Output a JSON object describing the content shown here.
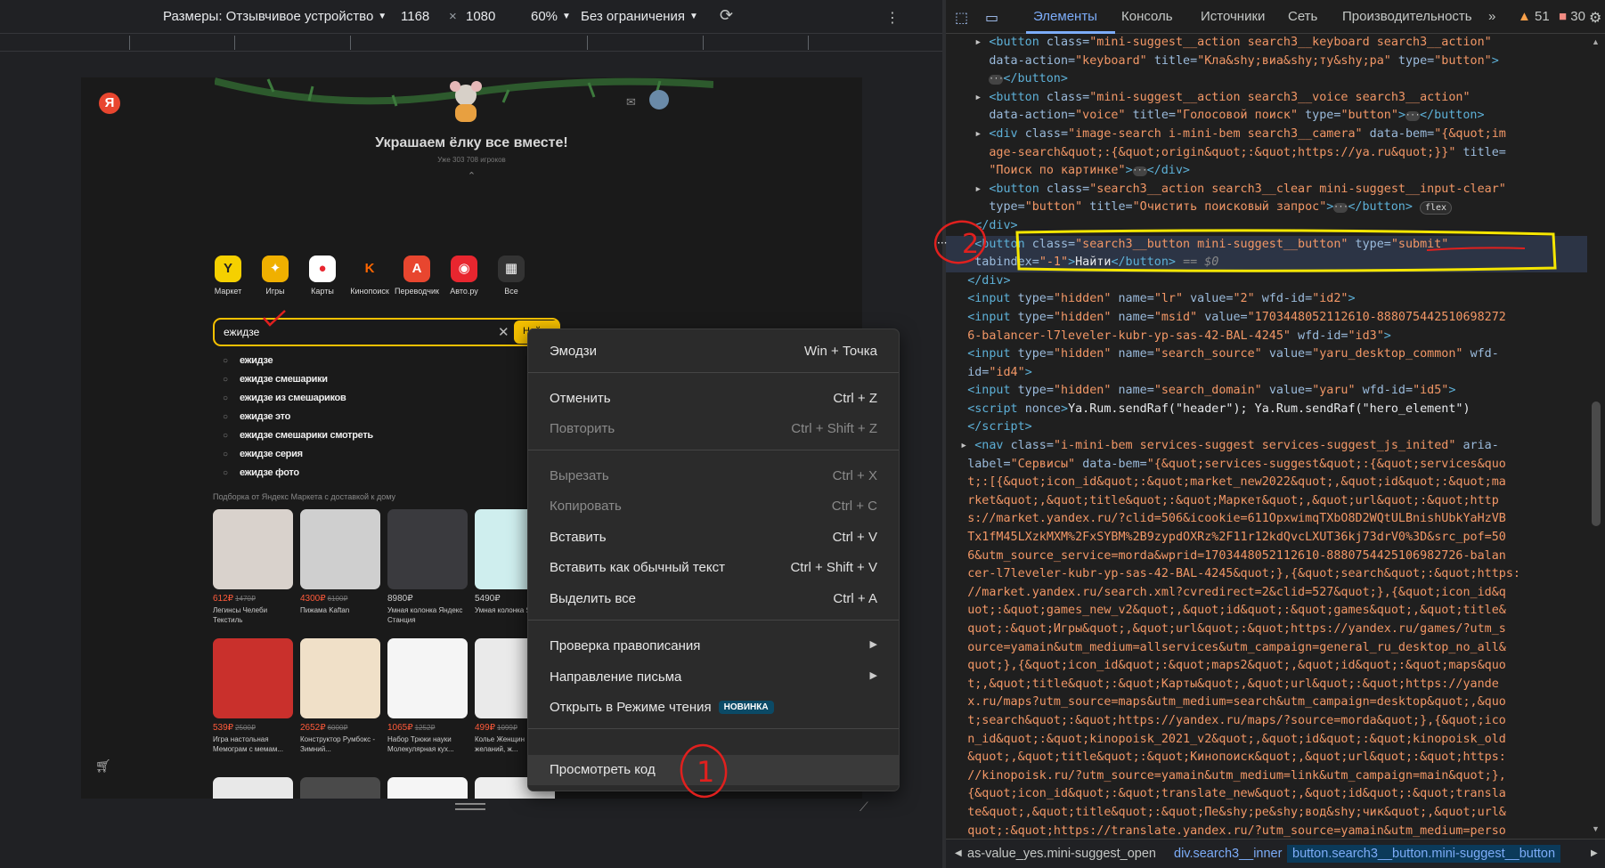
{
  "devbar": {
    "dimensions_label": "Размеры: Отзывчивое устройство",
    "width": "1168",
    "times": "×",
    "height": "1080",
    "zoom": "60%",
    "throttling": "Без ограничения"
  },
  "page": {
    "logo": "Я",
    "banner_title": "Украшаем ёлку все вместе!",
    "banner_sub": "Уже 303 708 игроков",
    "services": [
      {
        "label": "Маркет",
        "glyph": "Y",
        "color": "#f5d000"
      },
      {
        "label": "Игры",
        "glyph": "✦",
        "color": "#f0b000"
      },
      {
        "label": "Карты",
        "glyph": "●",
        "color": "#ffffff"
      },
      {
        "label": "Кинопоиск",
        "glyph": "K",
        "color": "#1a1a1a"
      },
      {
        "label": "Переводчик",
        "glyph": "A",
        "color": "#e8462f"
      },
      {
        "label": "Авто.ру",
        "glyph": "◉",
        "color": "#e8262f"
      },
      {
        "label": "Все",
        "glyph": "▦",
        "color": "#333333"
      }
    ],
    "search_query": "ежидзе",
    "search_button": "Найти",
    "suggestions": [
      "ежидзе",
      "ежидзе смешарики",
      "ежидзе из смешариков",
      "ежидзе это",
      "ежидзе смешарики смотреть",
      "ежидзе серия",
      "ежидзе фото"
    ],
    "market_sub": "Подборка от Яндекс Маркета с доставкой к дому",
    "products_row1": [
      {
        "price": "612₽",
        "old": "1470₽",
        "name": "Легинсы Челеби Текстиль",
        "color": "#d9d2cc"
      },
      {
        "price": "4300₽",
        "old": "6100₽",
        "name": "Пижама Kaftan",
        "color": "#cfcfcf"
      },
      {
        "price": "8980₽",
        "old": "",
        "name": "Умная колонка Яндекс Станция",
        "color": "#3a3a3e"
      },
      {
        "price": "5490₽",
        "old": "",
        "name": "Умная колонка Яндекс",
        "color": "#cfeeee"
      }
    ],
    "products_row2": [
      {
        "price": "539₽",
        "old": "2500₽",
        "name": "Игра настольная Мемограм с мемам...",
        "color": "#c9302c"
      },
      {
        "price": "2652₽",
        "old": "6000₽",
        "name": "Конструктор Румбокс - Зимний...",
        "color": "#f0e0c8"
      },
      {
        "price": "1065₽",
        "old": "1252₽",
        "name": "Набор Трюки науки Молекулярная кух...",
        "color": "#f5f5f5"
      },
      {
        "price": "499₽",
        "old": "1099₽",
        "name": "Колье Женщин желаний, ж...",
        "color": "#eaeaea"
      }
    ]
  },
  "context_menu": {
    "items": [
      {
        "label": "Эмодзи",
        "shortcut": "Win + Точка",
        "disabled": false
      },
      {
        "label": "Отменить",
        "shortcut": "Ctrl + Z",
        "disabled": false
      },
      {
        "label": "Повторить",
        "shortcut": "Ctrl + Shift + Z",
        "disabled": true
      },
      {
        "label": "Вырезать",
        "shortcut": "Ctrl + X",
        "disabled": true
      },
      {
        "label": "Копировать",
        "shortcut": "Ctrl + C",
        "disabled": true
      },
      {
        "label": "Вставить",
        "shortcut": "Ctrl + V",
        "disabled": false
      },
      {
        "label": "Вставить как обычный текст",
        "shortcut": "Ctrl + Shift + V",
        "disabled": false
      },
      {
        "label": "Выделить все",
        "shortcut": "Ctrl + A",
        "disabled": false
      },
      {
        "label": "Проверка правописания",
        "shortcut": "",
        "disabled": false
      },
      {
        "label": "Направление письма",
        "shortcut": "",
        "disabled": false
      },
      {
        "label": "Открыть в Режиме чтения",
        "shortcut": "",
        "disabled": false
      },
      {
        "label": "Просмотреть код",
        "shortcut": "",
        "disabled": false
      }
    ],
    "new_badge": "НОВИНКА"
  },
  "devtools": {
    "tabs": [
      "Элементы",
      "Консоль",
      "Источники",
      "Сеть",
      "Производительность"
    ],
    "more": "»",
    "warnings": "51",
    "errors": "30",
    "breadcrumbs": [
      "as-value_yes.mini-suggest_open",
      "div.search3__inner",
      "button.search3__button.mini-suggest__button"
    ]
  },
  "annotations": {
    "marker_1": "1",
    "marker_2": "2"
  },
  "colors": {
    "accent_yellow": "#f5c000",
    "devtools_blue": "#7cacf8",
    "annotation_red": "#e0201e",
    "highlight_yellow": "#f5e600"
  }
}
